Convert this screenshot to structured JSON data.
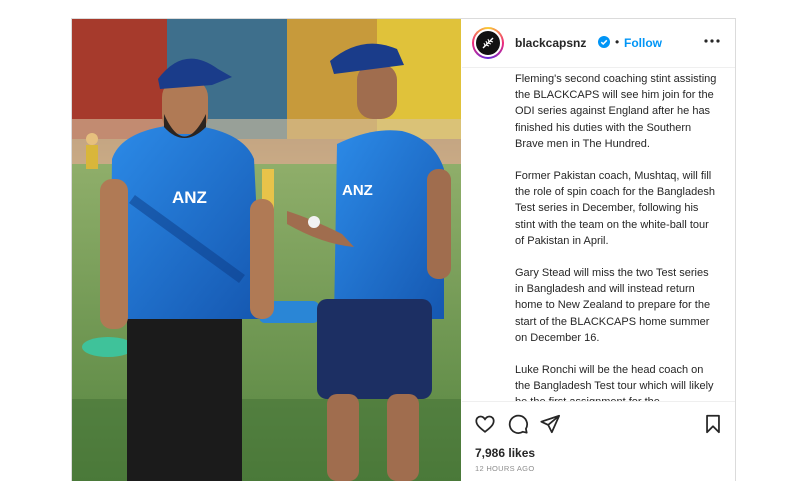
{
  "post": {
    "username": "blackcapsnz",
    "separator": "•",
    "follow_label": "Follow",
    "caption": [
      "Fleming's second coaching stint assisting the BLACKCAPS will see him join for the ODI series against England after he has finished his duties with the Southern Brave men in The Hundred.",
      "Former Pakistan coach, Mushtaq, will fill the role of spin coach for the Bangladesh Test series in December, following his stint with the team on the white-ball tour of Pakistan in April.",
      "Gary Stead will miss the two Test series in Bangladesh and will instead return home to New Zealand to prepare for the start of the BLACKCAPS home summer on December 16.",
      "Luke Ronchi will be the head coach on the Bangladesh Test tour which will likely be the first assignment for the"
    ],
    "likes": "7,986 likes",
    "timestamp": "12 HOURS AGO"
  },
  "photo": {
    "shirt_sponsor": "ANZ"
  },
  "colors": {
    "follow_blue": "#0095f6",
    "verified_blue": "#0095f6",
    "shirt_blue": "#1f6fd6",
    "grass_green": "#6c9a5c"
  },
  "icons": [
    "verified-badge-icon",
    "more-options-icon",
    "heart-icon",
    "comment-icon",
    "share-icon",
    "bookmark-icon",
    "fern-logo-icon"
  ]
}
